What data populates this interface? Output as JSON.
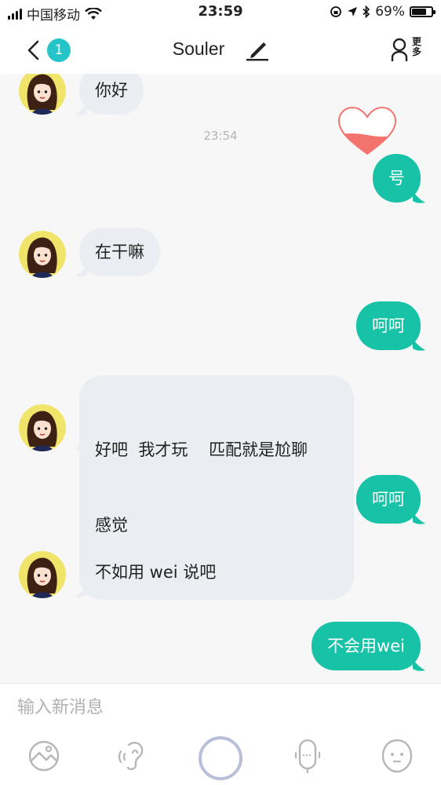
{
  "status_bar": {
    "carrier": "中国移动",
    "time": "23:59",
    "battery": "69%",
    "battery_level": 0.69
  },
  "header": {
    "unread_count": "1",
    "title": "Souler",
    "more_label": "更多"
  },
  "messages": [
    {
      "side": "in",
      "text": "你好"
    },
    {
      "type": "timestamp",
      "text": "23:54"
    },
    {
      "side": "out",
      "text": "号"
    },
    {
      "side": "in",
      "text": "在干嘛"
    },
    {
      "side": "out",
      "text": "呵呵"
    },
    {
      "side": "in",
      "text": "好吧  我才玩    匹配就是尬聊",
      "text2": "感觉"
    },
    {
      "side": "out",
      "text": "呵呵"
    },
    {
      "side": "in",
      "text": "不如用 wei 说吧"
    },
    {
      "side": "out",
      "text": "不会用wei"
    }
  ],
  "input": {
    "placeholder": "输入新消息",
    "value": ""
  },
  "toolbar": [
    "image-icon",
    "voice-icon",
    "record-circle-icon",
    "microphone-icon",
    "emoji-icon"
  ],
  "colors": {
    "outgoing_bubble": "#18c2a6",
    "incoming_bubble": "#eaedf1",
    "badge": "#25c4c9",
    "heart": "#f3736f"
  }
}
